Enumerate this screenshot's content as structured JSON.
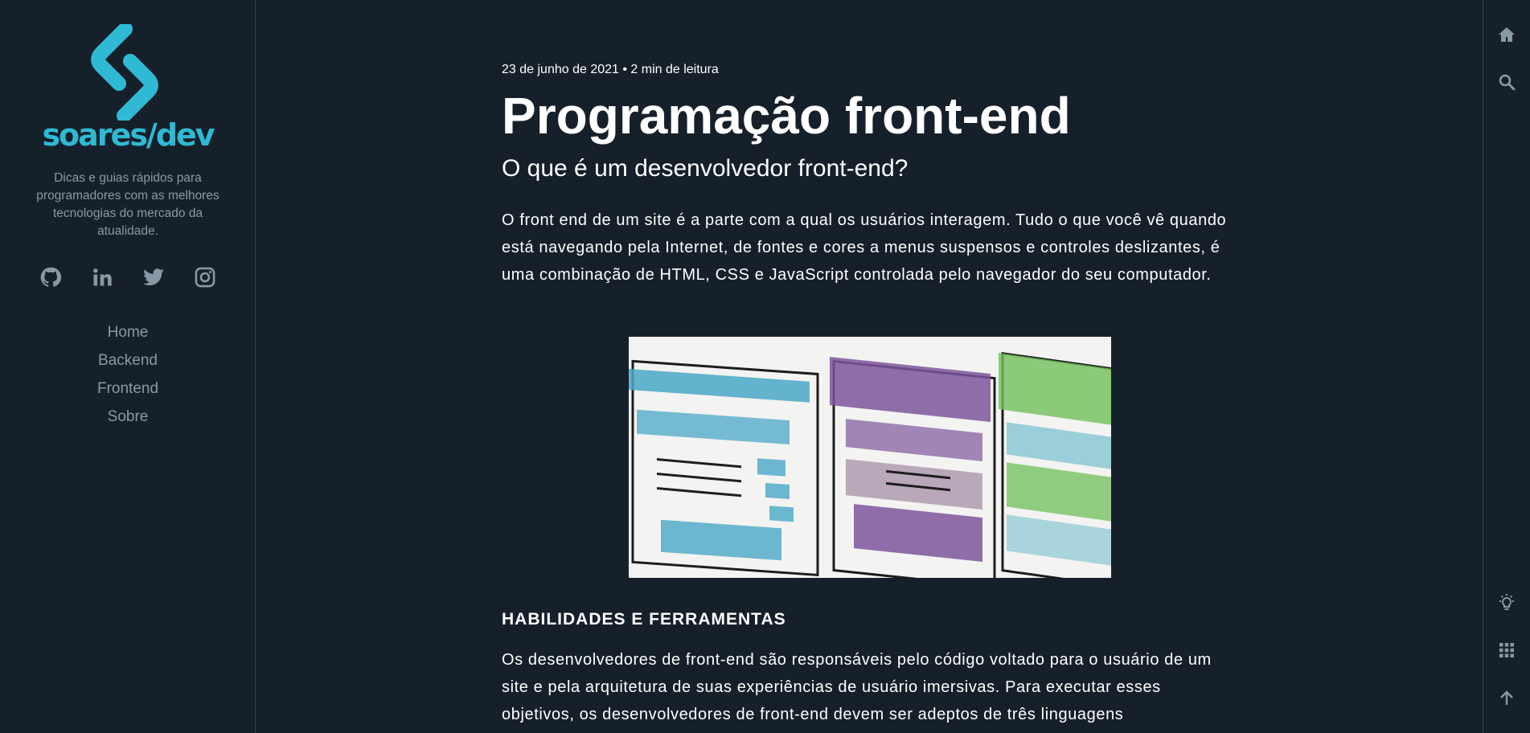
{
  "sidebar": {
    "logo_text": "soares/dev",
    "tagline": "Dicas e guias rápidos para programadores com as melhores tecnologias do mercado da atualidade.",
    "socials": [
      {
        "icon": "github-icon"
      },
      {
        "icon": "linkedin-icon"
      },
      {
        "icon": "twitter-icon"
      },
      {
        "icon": "instagram-icon"
      }
    ],
    "nav": [
      "Home",
      "Backend",
      "Frontend",
      "Sobre"
    ]
  },
  "article": {
    "meta": "23 de junho de 2021 • 2 min de leitura",
    "title": "Programação front-end",
    "subtitle": "O que é um desenvolvedor front-end?",
    "paragraph_1": "O front end de um site é a parte com a qual os usuários interagem. Tudo o que você vê quando está navegando pela Internet, de fontes e cores a menus suspensos e controles deslizantes, é uma combinação de HTML, CSS e JavaScript controlada pelo navegador do seu computador.",
    "section_heading": "HABILIDADES E FERRAMENTAS",
    "paragraph_2": "Os desenvolvedores de front-end são responsáveis pelo código voltado para o usuário de um site e pela arquitetura de suas experiências de usuário imersivas. Para executar esses objetivos, os desenvolvedores de front-end devem ser adeptos de três linguagens"
  },
  "rail": {
    "top": [
      {
        "icon": "home-icon"
      },
      {
        "icon": "search-icon"
      }
    ],
    "bottom": [
      {
        "icon": "lightbulb-icon"
      },
      {
        "icon": "grid-icon"
      },
      {
        "icon": "arrow-up-icon"
      }
    ]
  },
  "colors": {
    "background": "#16202a",
    "brand": "#2fb9d3",
    "muted_text": "#8899a6",
    "border": "#38444d"
  }
}
